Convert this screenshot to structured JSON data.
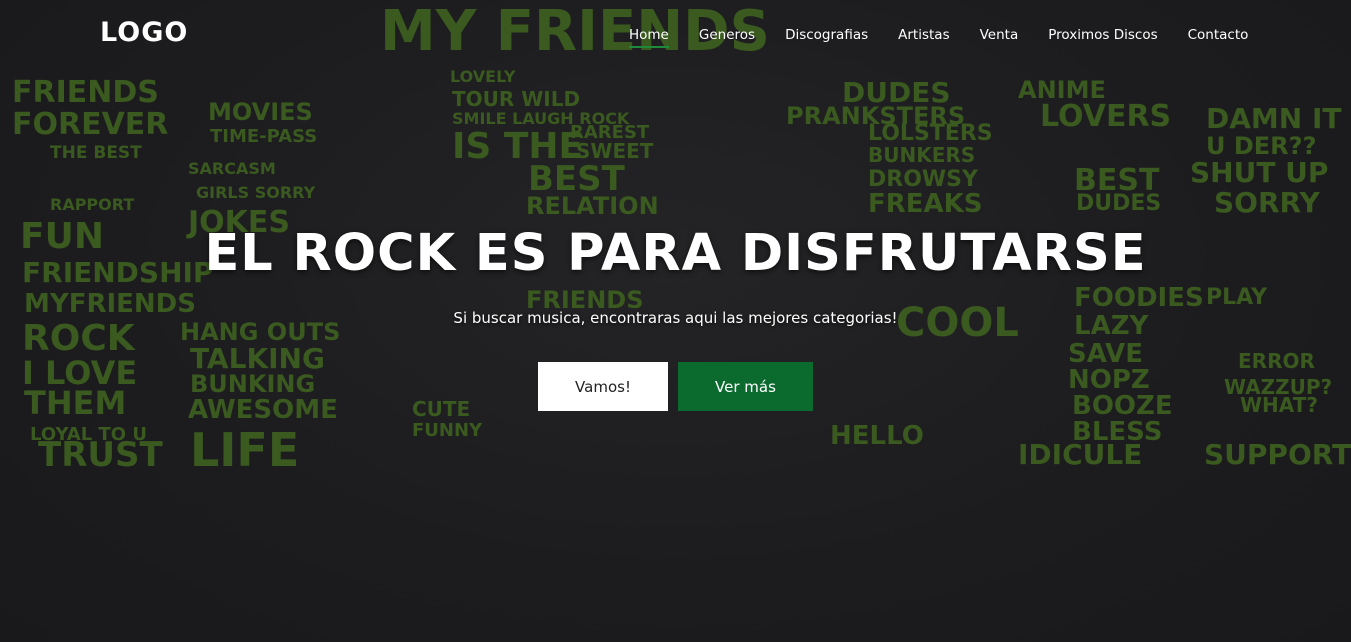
{
  "navbar": {
    "logo": "LOGO",
    "links": [
      {
        "label": "Home",
        "active": true
      },
      {
        "label": "Generos",
        "active": false
      },
      {
        "label": "Discografias",
        "active": false
      },
      {
        "label": "Artistas",
        "active": false
      },
      {
        "label": "Venta",
        "active": false
      },
      {
        "label": "Proximos Discos",
        "active": false
      },
      {
        "label": "Contacto",
        "active": false
      }
    ]
  },
  "hero": {
    "title": "EL ROCK ES PARA DISFRUTARSE",
    "subtitle": "Si buscar musica, encontraras aqui las mejores categorias!",
    "primary_button": "Vamos!",
    "secondary_button": "Ver más"
  },
  "background_art": {
    "words": [
      "MY FRIENDS",
      "FRIENDS",
      "FOREVER",
      "THE BEST",
      "RAPPORT",
      "FUN",
      "FRIENDSHIP",
      "MYFRIENDS",
      "ROCK",
      "I LOVE",
      "THEM",
      "LOYAL TO U",
      "TRUST",
      "MOVIES",
      "TIME-PASS",
      "SARCASM",
      "GIRLS SORRY",
      "JOKES",
      "HANG OUTS",
      "TALKING",
      "BUNKING",
      "AWESOME",
      "LIFE",
      "LOVELY",
      "TOUR WILD",
      "SMILE LAUGH ROCK",
      "IS THE",
      "RAREST",
      "SWEET",
      "BEST",
      "RELATION",
      "FRIENDS",
      "CUTE",
      "FUNNY",
      "DUDES",
      "PRANKSTERS",
      "LOLSTERS",
      "BUNKERS",
      "DROWSY",
      "FREAKS",
      "COOL",
      "HELLO",
      "ANIME",
      "LOVERS",
      "BEST",
      "DUDES",
      "FOODIES",
      "LAZY",
      "SAVE",
      "NOPZ",
      "BOOZE",
      "BLESS",
      "IDICULE",
      "DAMN IT",
      "U DER??",
      "SHUT UP",
      "SORRY",
      "PLAY",
      "ERROR",
      "WAZZUP?",
      "WHAT?",
      "SUPPORT"
    ],
    "color": "#3a5a1f"
  },
  "colors": {
    "background": "#1c1c1e",
    "accent_green": "#0b6b2e",
    "nav_underline": "#1f8a3a"
  }
}
